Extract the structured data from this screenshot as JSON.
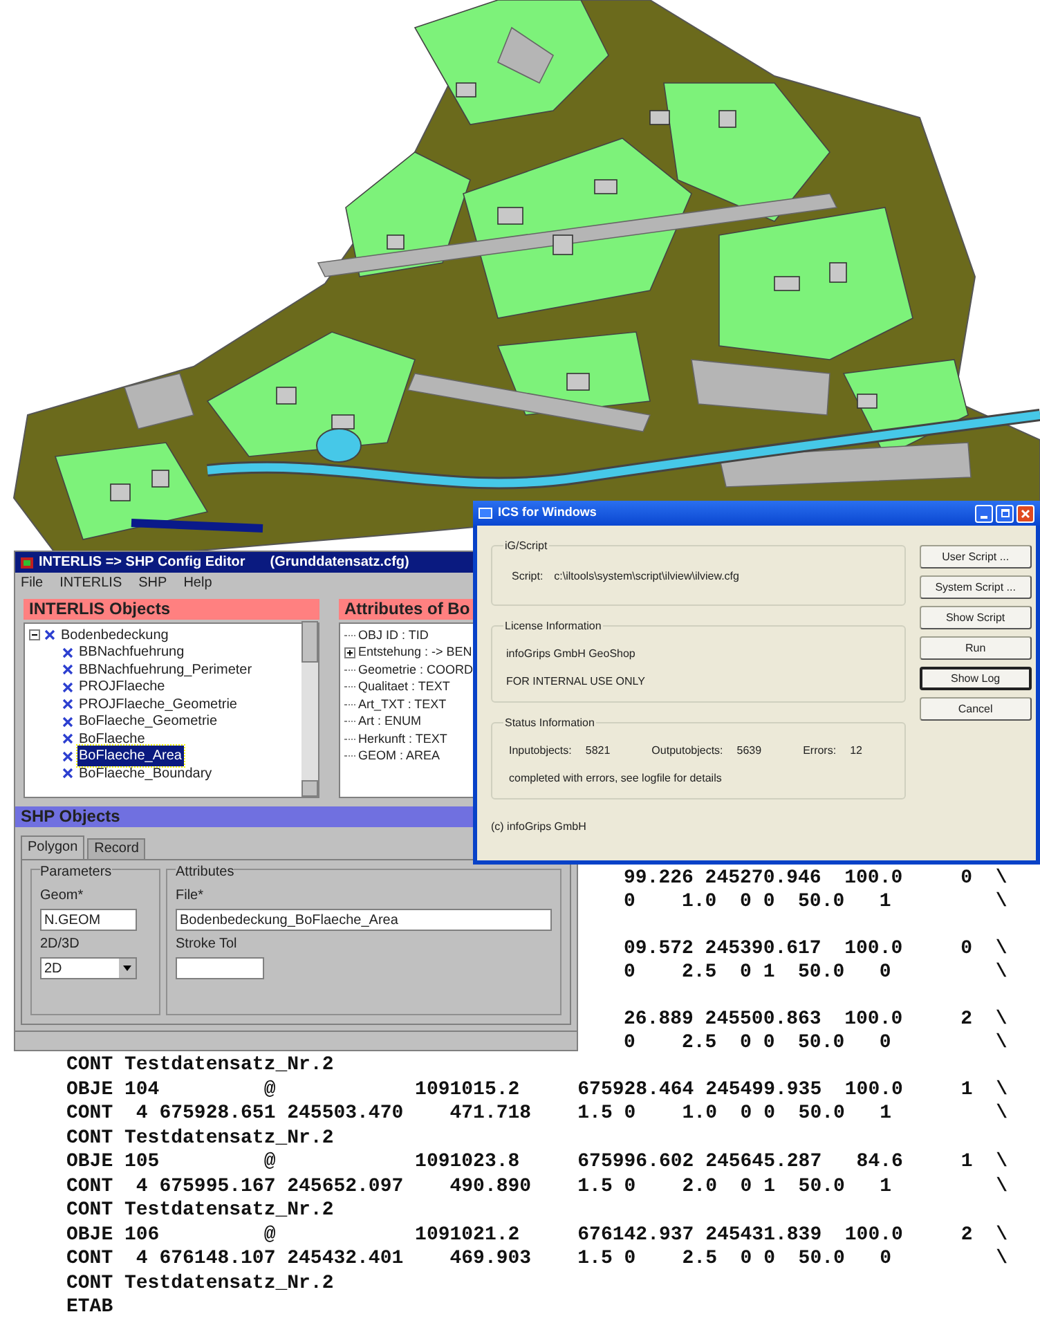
{
  "config_editor": {
    "title": "INTERLIS => SHP Config Editor",
    "file": "(Grunddatensatz.cfg)",
    "menu": [
      "File",
      "INTERLIS",
      "SHP",
      "Help"
    ],
    "objects_panel": {
      "title": "INTERLIS Objects",
      "tree": [
        {
          "label": "Bodenbedeckung",
          "expanded": true,
          "selected": false,
          "children": [
            {
              "label": "BBNachfuehrung",
              "selected": false
            },
            {
              "label": "BBNachfuehrung_Perimeter",
              "selected": false
            },
            {
              "label": "PROJFlaeche",
              "selected": false
            },
            {
              "label": "PROJFlaeche_Geometrie",
              "selected": false
            },
            {
              "label": "BoFlaeche_Geometrie",
              "selected": false
            },
            {
              "label": "BoFlaeche",
              "selected": false
            },
            {
              "label": "BoFlaeche_Area",
              "selected": true
            },
            {
              "label": "BoFlaeche_Boundary",
              "selected": false
            }
          ]
        }
      ]
    },
    "attributes_panel": {
      "title": "Attributes of Bo",
      "items": [
        {
          "label": "OBJ ID : TID",
          "kind": "leaf"
        },
        {
          "label": "Entstehung : -> BEN",
          "kind": "node"
        },
        {
          "label": "Geometrie : COORD",
          "kind": "leaf"
        },
        {
          "label": "Qualitaet : TEXT",
          "kind": "leaf"
        },
        {
          "label": "Art_TXT : TEXT",
          "kind": "leaf"
        },
        {
          "label": "Art : ENUM",
          "kind": "leaf"
        },
        {
          "label": "Herkunft : TEXT",
          "kind": "leaf"
        },
        {
          "label": "GEOM : AREA",
          "kind": "leaf"
        }
      ]
    },
    "shp_panel": {
      "title": "SHP Objects",
      "tabs": [
        {
          "label": "Polygon",
          "selected": true
        },
        {
          "label": "Record",
          "selected": false
        }
      ],
      "parameters": {
        "title": "Parameters",
        "geom_label": "Geom*",
        "geom_value": "N.GEOM",
        "dim_label": "2D/3D",
        "dim_value": "2D"
      },
      "attributes": {
        "title": "Attributes",
        "file_label": "File*",
        "file_value": "Bodenbedeckung_BoFlaeche_Area",
        "stroke_label": "Stroke Tol"
      }
    }
  },
  "ics_window": {
    "title": "ICS for Windows",
    "script_group": {
      "title": "iG/Script",
      "label": "Script:",
      "value": "c:\\iltools\\system\\script\\ilview\\ilview.cfg"
    },
    "license_group": {
      "title": "License Information",
      "lines": [
        "infoGrips GmbH GeoShop",
        "FOR INTERNAL USE ONLY"
      ]
    },
    "status_group": {
      "title": "Status Information",
      "fields": [
        {
          "label": "Inputobjects:",
          "value": "5821"
        },
        {
          "label": "Outputobjects:",
          "value": "5639"
        },
        {
          "label": "Errors:",
          "value": "12"
        }
      ],
      "message": "completed with errors, see logfile for details"
    },
    "copyright": "(c) infoGrips GmbH",
    "buttons": [
      {
        "label": "User Script ...",
        "focused": false
      },
      {
        "label": "System Script ...",
        "focused": false
      },
      {
        "label": "Show Script",
        "focused": false
      },
      {
        "label": "Run",
        "focused": false
      },
      {
        "label": "Show Log",
        "focused": true
      },
      {
        "label": "Cancel",
        "focused": false
      }
    ]
  },
  "listing": {
    "fragments": [
      [
        "99.226 245270.946  100.0     0  \\",
        "0    1.0  0 0  50.0   1         \\"
      ],
      [
        "09.572 245390.617  100.0     0  \\",
        "0    2.5  0 1  50.0   0         \\"
      ],
      [
        "26.889 245500.863  100.0     2  \\",
        "0    2.5  0 0  50.0   0         \\"
      ]
    ],
    "lines": [
      "CONT Testdatensatz_Nr.2",
      "OBJE 104         @            1091015.2     675928.464 245499.935  100.0     1  \\",
      "CONT  4 675928.651 245503.470    471.718    1.5 0    1.0  0 0  50.0   1         \\",
      "CONT Testdatensatz_Nr.2",
      "OBJE 105         @            1091023.8     675996.602 245645.287   84.6     1  \\",
      "CONT  4 675995.167 245652.097    490.890    1.5 0    2.0  0 1  50.0   1         \\",
      "CONT Testdatensatz_Nr.2",
      "OBJE 106         @            1091021.2     676142.937 245431.839  100.0     2  \\",
      "CONT  4 676148.107 245432.401    469.903    1.5 0    2.5  0 0  50.0   0         \\",
      "CONT Testdatensatz_Nr.2",
      "ETAB"
    ]
  }
}
